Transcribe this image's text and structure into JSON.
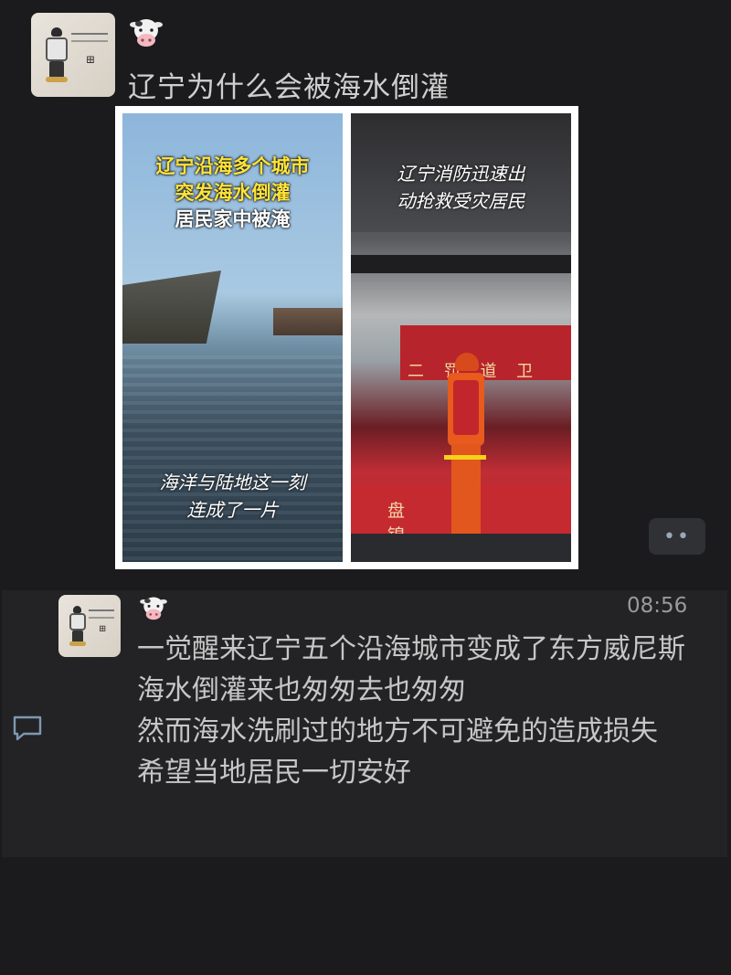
{
  "post": {
    "title": "辽宁为什么会被海水倒灌",
    "image": {
      "left_caption_lines": [
        "辽宁沿海多个城市",
        "突发海水倒灌"
      ],
      "left_caption_white": "居民家中被淹",
      "left_bottom_caption_lines": [
        "海洋与陆地这一刻",
        "连成了一片"
      ],
      "right_caption_lines": [
        "辽宁消防迅速出",
        "动抢救受灾居民"
      ],
      "right_banner": "二 罚 道 卫",
      "right_boat": "盘 锦 防"
    },
    "more_label": "••"
  },
  "reply": {
    "time": "08:56",
    "lines": [
      "一觉醒来辽宁五个沿海城市变成了东方威尼斯",
      "海水倒灌来也匆匆去也匆匆",
      "然而海水洗刷过的地方不可避免的造成损失",
      "希望当地居民一切安好"
    ]
  },
  "icons": {
    "avatar_top": "user-avatar-icon",
    "cow_top": "cow-emoji-icon",
    "avatar_reply": "user-avatar-icon",
    "cow_reply": "cow-emoji-icon",
    "comment": "comment-icon",
    "more": "more-dots-icon"
  },
  "colors": {
    "background": "#1b1b1d",
    "reply_background": "#232325",
    "caption_yellow": "#ffe43a",
    "more_button": "#2f3135"
  }
}
